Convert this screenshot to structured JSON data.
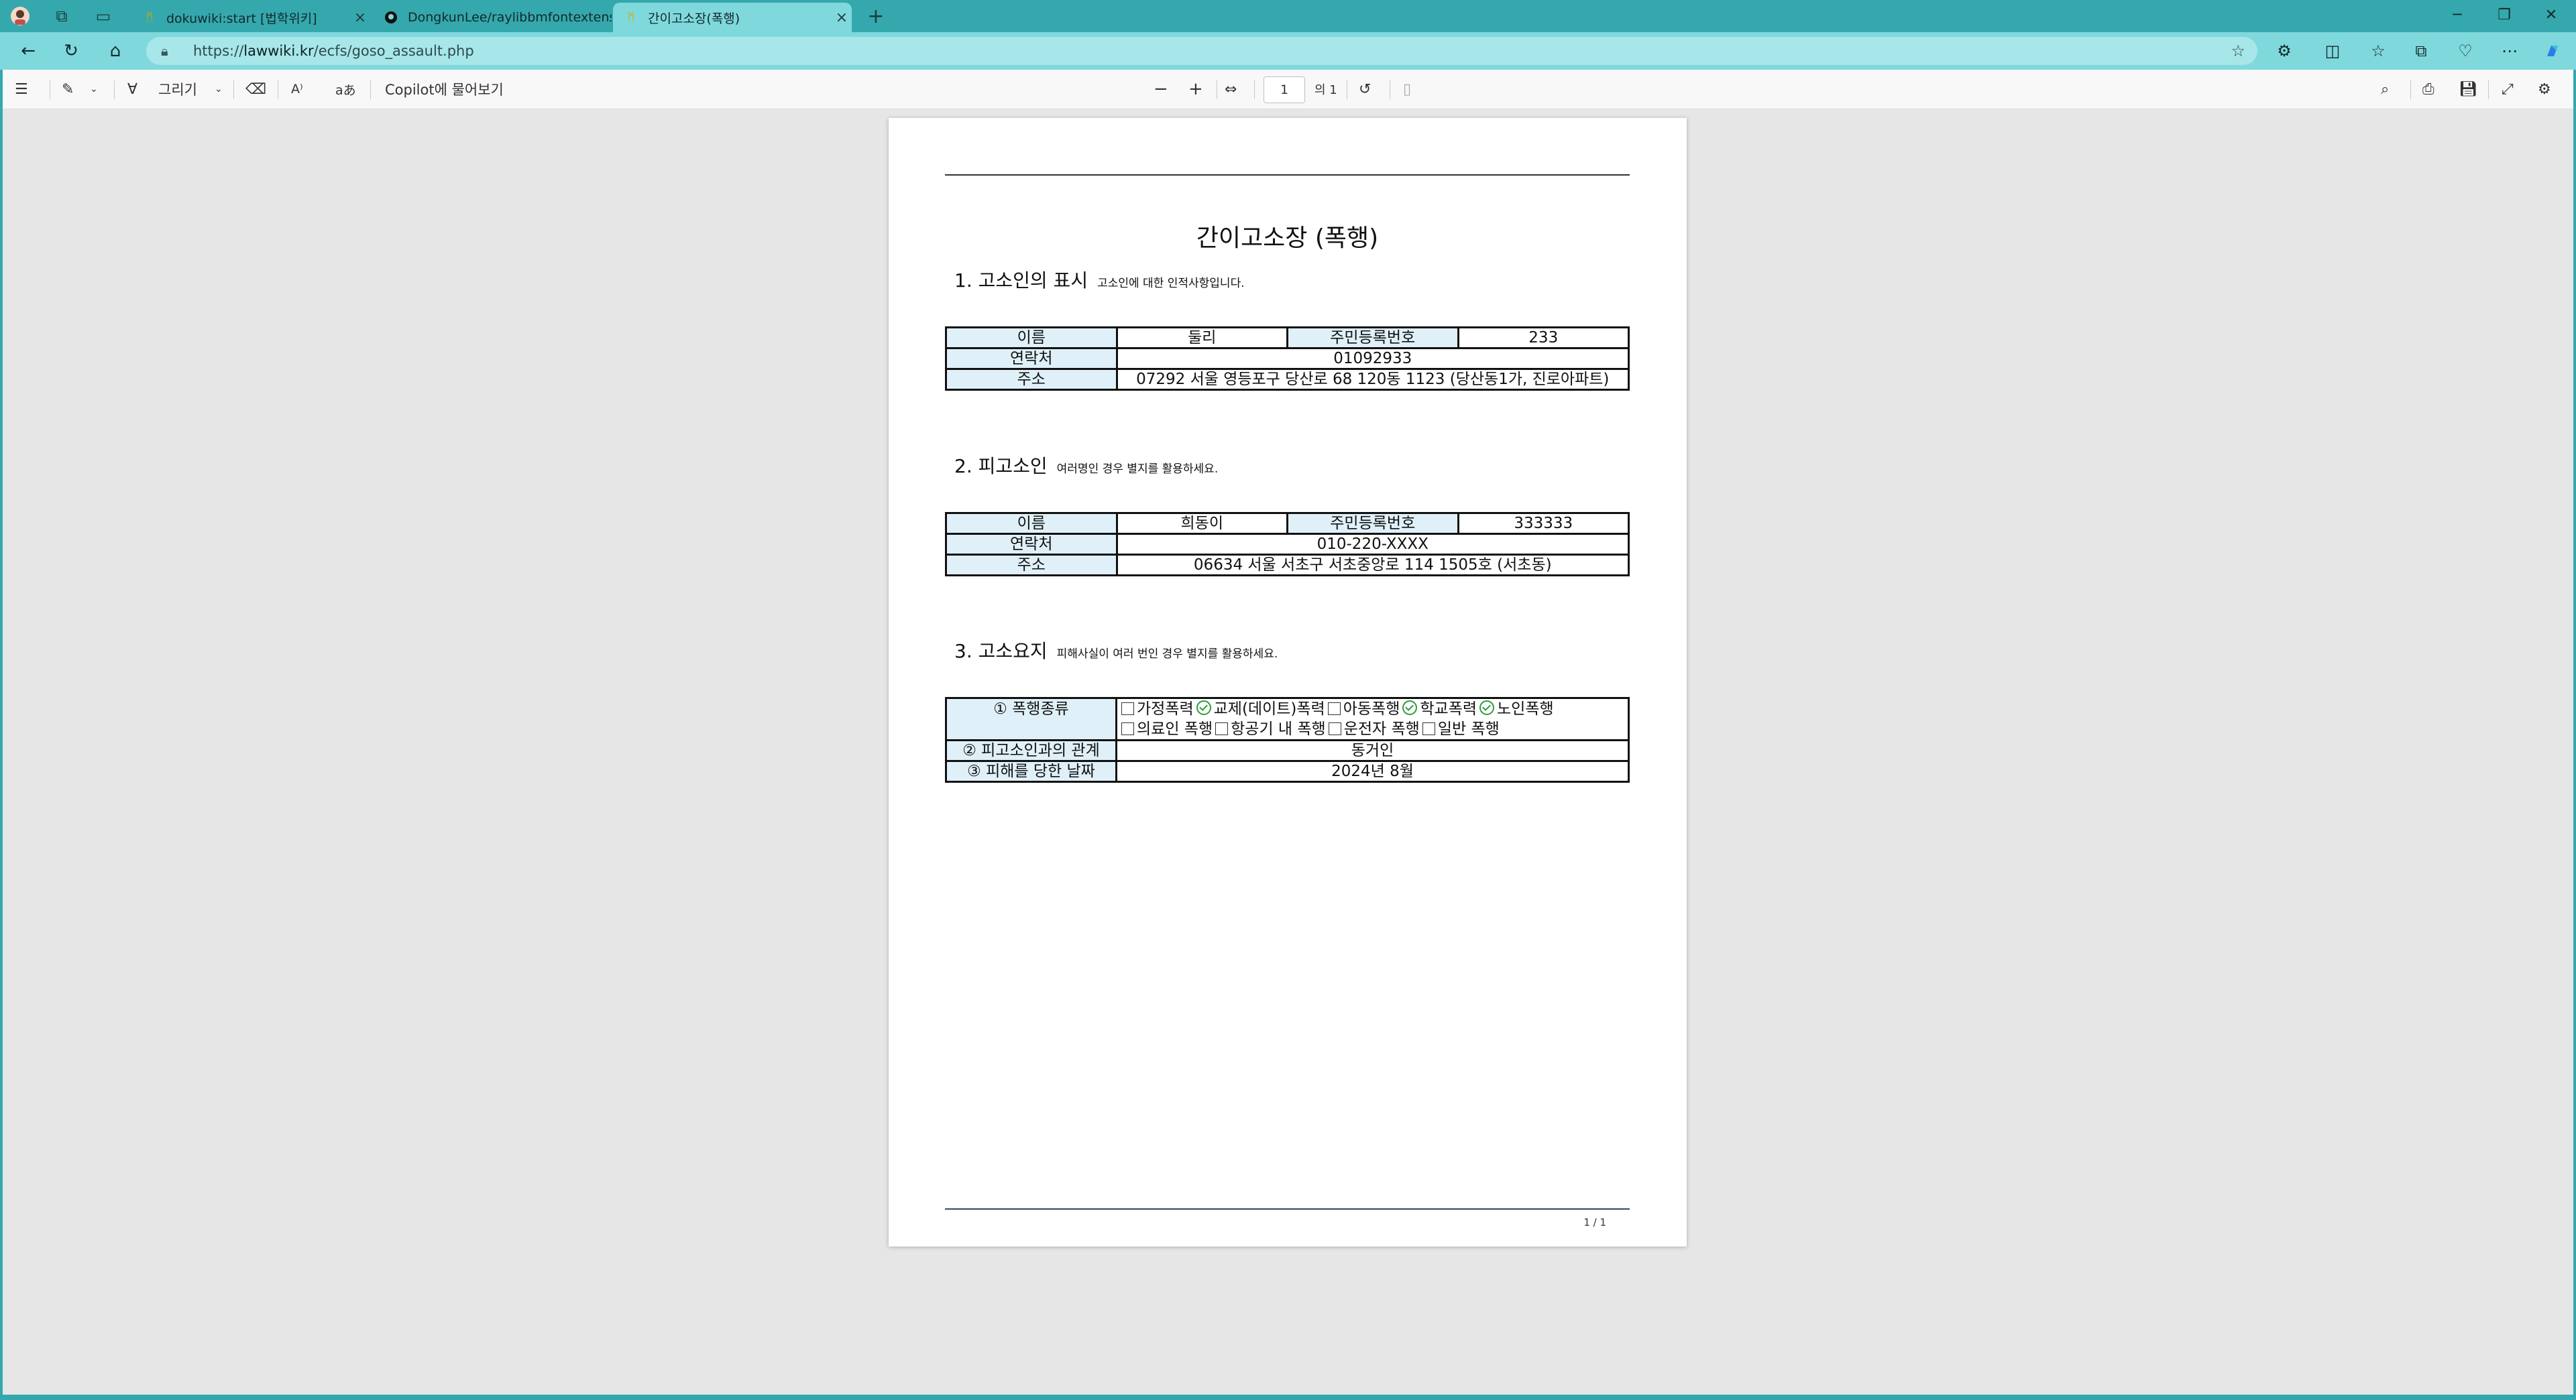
{
  "browser": {
    "tabs": [
      {
        "title": "dokuwiki:start [법학위키]",
        "active": false
      },
      {
        "title": "DongkunLee/raylibbmfontextens",
        "active": false
      },
      {
        "title": "간이고소장(폭행)",
        "active": true
      }
    ],
    "new_tab": "+",
    "url_prefix": "https://",
    "url_domain": "lawwiki.kr",
    "url_path": "/ecfs/goso_assault.php"
  },
  "pdf_toolbar": {
    "draw_label": "그리기",
    "copilot_label": "Copilot에 물어보기",
    "page_current": "1",
    "page_total": "의 1",
    "zoom_out": "−",
    "zoom_in": "+"
  },
  "document": {
    "title": "간이고소장 (폭행)",
    "section1": {
      "heading": "1. 고소인의 표시",
      "note": "고소인에 대한 인적사항입니다."
    },
    "complainant": {
      "name_label": "이름",
      "name": "둘리",
      "id_label": "주민등록번호",
      "id": "233",
      "contact_label": "연락처",
      "contact": "01092933",
      "address_label": "주소",
      "address": "07292 서울 영등포구 당산로 68 120동 1123 (당산동1가, 진로아파트)"
    },
    "section2": {
      "heading": "2. 피고소인",
      "note": "여러명인 경우 별지를 활용하세요."
    },
    "defendant": {
      "name_label": "이름",
      "name": "희동이",
      "id_label": "주민등록번호",
      "id": "333333",
      "contact_label": "연락처",
      "contact": "010-220-XXXX",
      "address_label": "주소",
      "address": "06634 서울 서초구 서초중앙로 114 1505호 (서초동)"
    },
    "section3": {
      "heading": "3. 고소요지",
      "note": "피해사실이 여러 번인 경우 별지를 활용하세요."
    },
    "summary": {
      "type_label": "① 폭행종류",
      "options": [
        {
          "label": "가정폭력",
          "checked": false
        },
        {
          "label": "교제(데이트)폭력",
          "checked": true
        },
        {
          "label": "아동폭행",
          "checked": false
        },
        {
          "label": "학교폭력",
          "checked": true
        },
        {
          "label": "노인폭행",
          "checked": true
        },
        {
          "label": "의료인 폭행",
          "checked": false
        },
        {
          "label": "항공기 내 폭행",
          "checked": false
        },
        {
          "label": "운전자 폭행",
          "checked": false
        },
        {
          "label": "일반 폭행",
          "checked": false
        }
      ],
      "relation_label": "② 피고소인과의 관계",
      "relation": "동거인",
      "date_label": "③ 피해를 당한 날짜",
      "date": "2024년 8월"
    },
    "page_footer": "1 / 1"
  }
}
